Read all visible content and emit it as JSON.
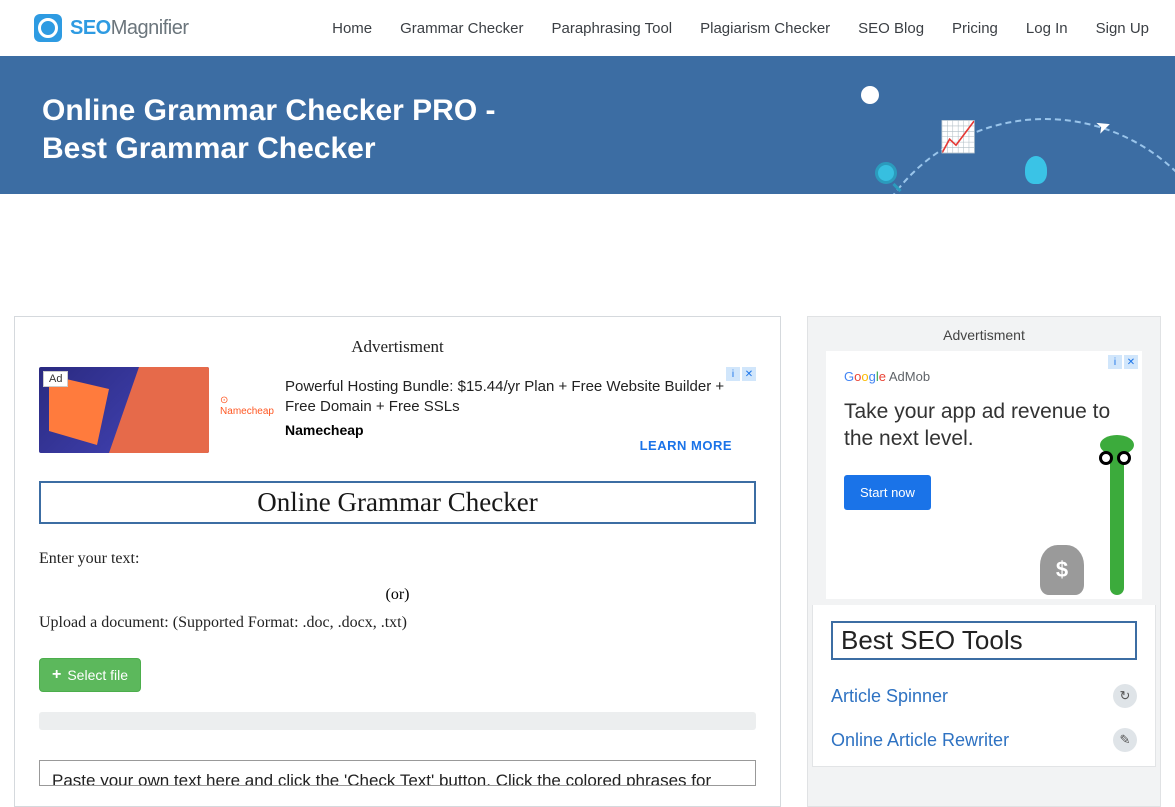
{
  "brand": {
    "bold": "SEO",
    "light": "Magnifier"
  },
  "nav": {
    "home": "Home",
    "grammar": "Grammar Checker",
    "paraphrase": "Paraphrasing Tool",
    "plagiarism": "Plagiarism Checker",
    "blog": "SEO Blog",
    "pricing": "Pricing",
    "login": "Log In",
    "signup": "Sign Up"
  },
  "hero": {
    "line1": "Online Grammar Checker PRO -",
    "line2": "Best Grammar Checker"
  },
  "main": {
    "adv_label": "Advertisment",
    "ad": {
      "badge": "Ad",
      "logo": "Namecheap",
      "copy": "Powerful Hosting Bundle: $15.44/yr Plan + Free Website Builder + Free Domain + Free SSLs",
      "brand": "Namecheap",
      "cta": "LEARN MORE",
      "info": "i",
      "close": "✕"
    },
    "tool_title": "Online Grammar Checker",
    "enter_text": "Enter your text:",
    "or": "(or)",
    "upload_label": "Upload a document: (Supported Format: .doc, .docx, .txt)",
    "select_file": "Select file",
    "textarea_placeholder": "Paste your own text here and click the 'Check Text' button. Click the colored phrases for"
  },
  "sidebar": {
    "adv_label": "Advertisment",
    "ad": {
      "provider_html": "Google AdMob",
      "text": "Take your app ad revenue to the next level.",
      "cta": "Start now",
      "info": "i",
      "close": "✕",
      "bag": "$"
    },
    "tools_title": "Best SEO Tools",
    "tool1": "Article Spinner",
    "tool2": "Online Article Rewriter"
  }
}
